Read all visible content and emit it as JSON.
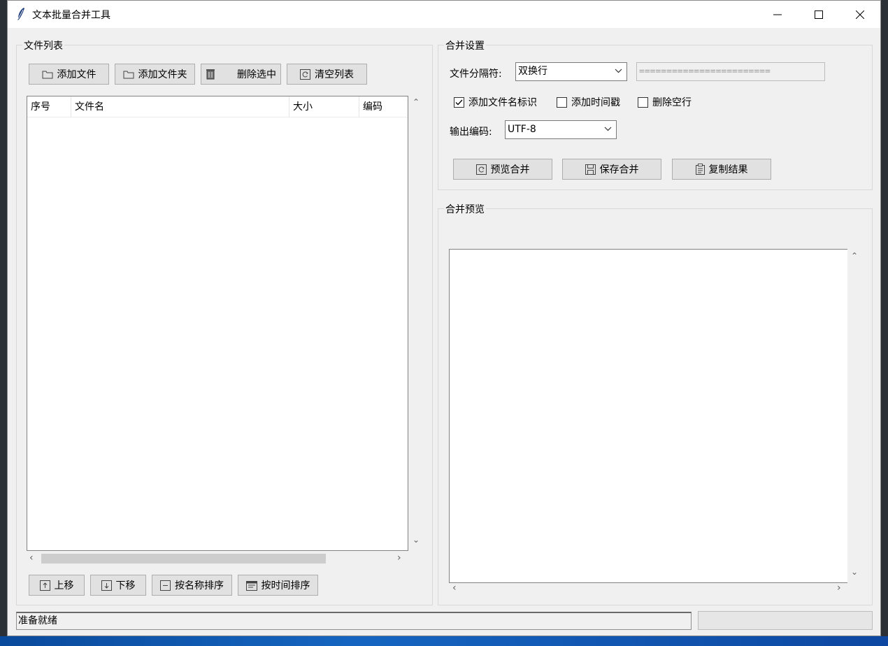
{
  "window": {
    "title": "文本批量合并工具",
    "controls": {
      "minimize": "minimize",
      "maximize": "maximize",
      "close": "close"
    }
  },
  "file_list": {
    "group_label": "文件列表",
    "toolbar": {
      "add_file": "添加文件",
      "add_folder": "添加文件夹",
      "delete_selected": "删除选中",
      "clear_list": "清空列表"
    },
    "columns": [
      "序号",
      "文件名",
      "大小",
      "编码"
    ],
    "rows": [],
    "bottom_buttons": {
      "move_up": "上移",
      "move_down": "下移",
      "sort_by_name": "按名称排序",
      "sort_by_time": "按时间排序"
    }
  },
  "merge_settings": {
    "group_label": "合并设置",
    "separator_label": "文件分隔符:",
    "separator_value": "双换行",
    "custom_separator": "========================",
    "options": [
      {
        "label": "添加文件名标识",
        "checked": true
      },
      {
        "label": "添加时间戳",
        "checked": false
      },
      {
        "label": "删除空行",
        "checked": false
      }
    ],
    "output_encoding_label": "输出编码:",
    "output_encoding_value": "UTF-8",
    "actions": {
      "preview": "预览合并",
      "save": "保存合并",
      "copy": "复制结果"
    }
  },
  "merge_preview": {
    "group_label": "合并预览",
    "content": ""
  },
  "status": {
    "text": "准备就绪",
    "progress": 0
  }
}
